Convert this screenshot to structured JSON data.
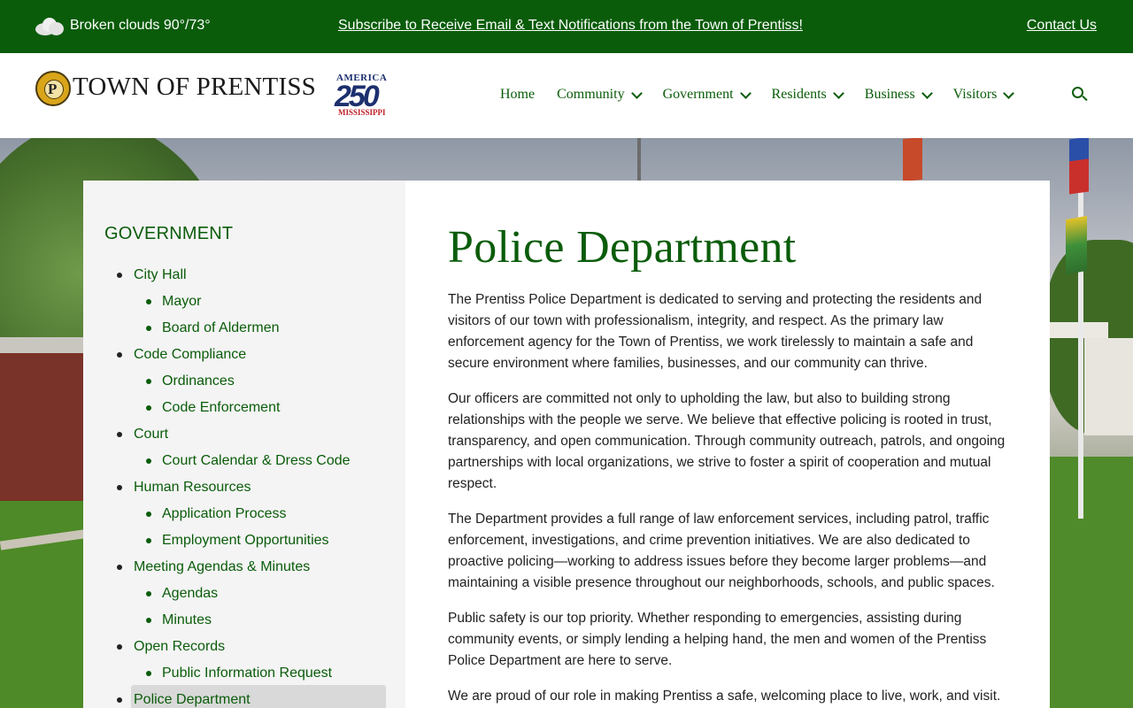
{
  "topbar": {
    "weather_text": "Broken clouds 90°/73°",
    "weather_icon": "cloud-icon",
    "subscribe_link": "Subscribe to Receive Email & Text Notifications from the Town of Prentiss!",
    "contact_link": "Contact Us"
  },
  "header": {
    "title": "TOWN OF PRENTISS",
    "badge_top": "AMERICA",
    "badge_number": "250",
    "badge_bottom": "MISSISSIPPI",
    "nav": [
      {
        "label": "Home",
        "has_dropdown": false
      },
      {
        "label": "Community",
        "has_dropdown": true
      },
      {
        "label": "Government",
        "has_dropdown": true
      },
      {
        "label": "Residents",
        "has_dropdown": true
      },
      {
        "label": "Business",
        "has_dropdown": true
      },
      {
        "label": "Visitors",
        "has_dropdown": true
      }
    ],
    "search_icon": "search-icon"
  },
  "sidebar": {
    "heading": "GOVERNMENT",
    "items": [
      {
        "label": "City Hall",
        "level": 1
      },
      {
        "label": "Mayor",
        "level": 2
      },
      {
        "label": "Board of Aldermen",
        "level": 2
      },
      {
        "label": "Code Compliance",
        "level": 1
      },
      {
        "label": "Ordinances",
        "level": 2
      },
      {
        "label": "Code Enforcement",
        "level": 2
      },
      {
        "label": "Court",
        "level": 1
      },
      {
        "label": "Court Calendar & Dress Code",
        "level": 2
      },
      {
        "label": "Human Resources",
        "level": 1
      },
      {
        "label": "Application Process",
        "level": 2
      },
      {
        "label": "Employment Opportunities",
        "level": 2
      },
      {
        "label": "Meeting Agendas & Minutes",
        "level": 1
      },
      {
        "label": "Agendas",
        "level": 2
      },
      {
        "label": "Minutes",
        "level": 2
      },
      {
        "label": "Open Records",
        "level": 1
      },
      {
        "label": "Public Information Request",
        "level": 2
      },
      {
        "label": "Police Department",
        "level": 1,
        "active": true
      }
    ]
  },
  "main": {
    "title": "Police Department",
    "paragraphs": [
      "The Prentiss Police Department is dedicated to serving and protecting the residents and visitors of our town with professionalism, integrity, and respect. As the primary law enforcement agency for the Town of Prentiss, we work tirelessly to maintain a safe and secure environment where families, businesses, and our community can thrive.",
      "Our officers are committed not only to upholding the law, but also to building strong relationships with the people we serve. We believe that effective policing is rooted in trust, transparency, and open communication. Through community outreach, patrols, and ongoing partnerships with local organizations, we strive to foster a spirit of cooperation and mutual respect.",
      "The Department provides a full range of law enforcement services, including patrol, traffic enforcement, investigations, and crime prevention initiatives. We are also dedicated to proactive policing—working to address issues before they become larger problems—and maintaining a visible presence throughout our neighborhoods, schools, and public spaces.",
      "Public safety is our top priority. Whether responding to emergencies, assisting during community events, or simply lending a helping hand, the men and women of the Prentiss Police Department are here to serve.",
      "We are proud of our role in making Prentiss a safe, welcoming place to live, work, and visit."
    ]
  },
  "colors": {
    "brand_green": "#0a5c0a",
    "sidebar_bg": "#f4f4f4",
    "active_bg": "#d9d9d9"
  }
}
